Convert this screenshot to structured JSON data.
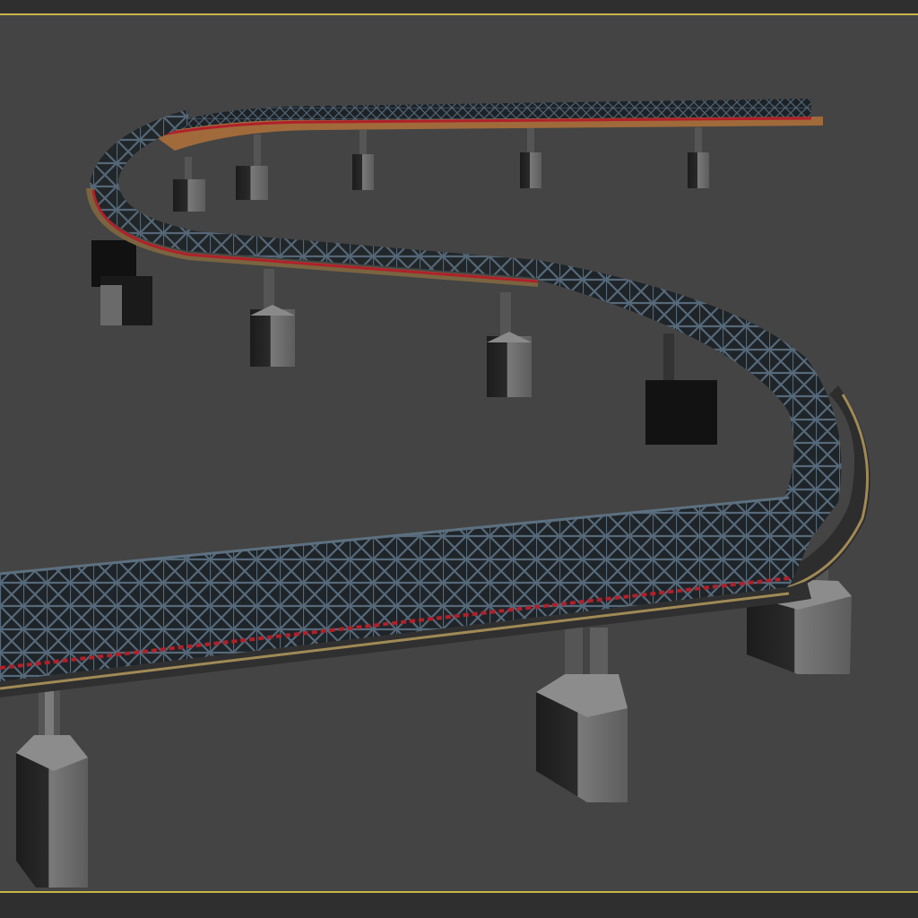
{
  "viewport": {
    "kind": "3d-perspective-viewport",
    "background": "#444444",
    "frame_color": "#2f2f2f",
    "active_border_color": "#c8b44a"
  },
  "scene": {
    "subject": "s-curve-elevated-truss-bridge",
    "truss_color": "#4a5a66",
    "deck_color": "#3a3a3a",
    "deck_edge_color": "#a08a55",
    "accent_color": "#b0202a",
    "pier_color": "#6d6d6d",
    "pier_shadow_color": "#1a1a1a"
  }
}
